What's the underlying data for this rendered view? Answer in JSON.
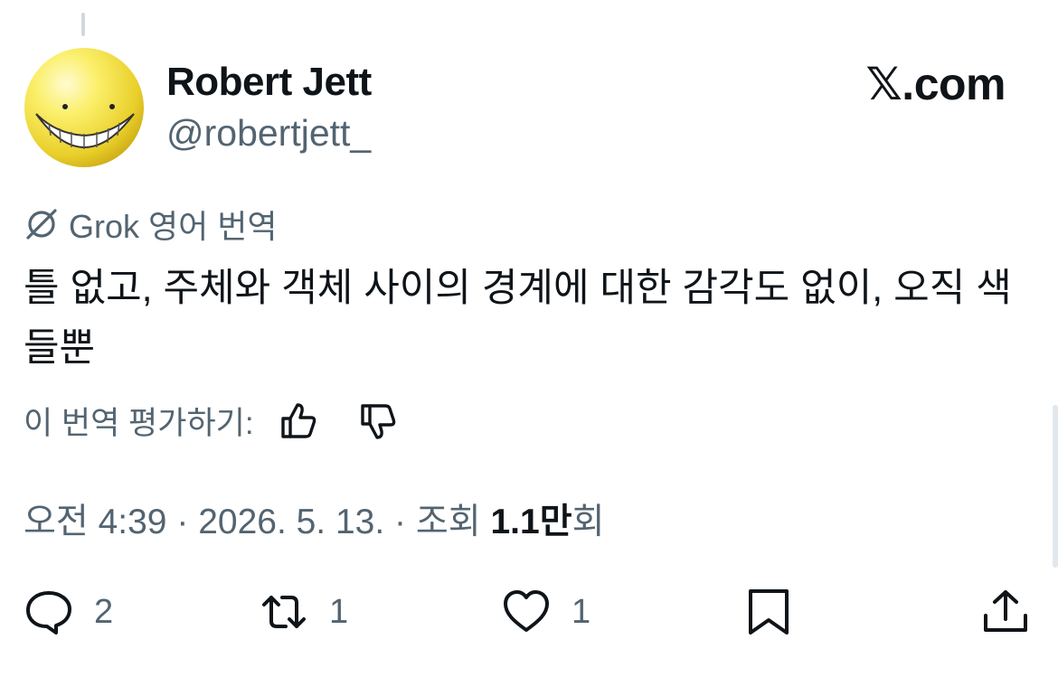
{
  "author": {
    "display_name": "Robert Jett",
    "handle": "@robertjett_",
    "avatar_icon": "yellow-smiley-face-icon"
  },
  "brand": {
    "label": "𝕏.com"
  },
  "translation": {
    "label": "Grok 영어 번역",
    "icon": "grok-icon",
    "rate_prompt": "이 번역 평가하기:",
    "thumbs_up_icon": "thumbs-up-icon",
    "thumbs_down_icon": "thumbs-down-icon"
  },
  "tweet": {
    "text": "틀 없고, 주체와 객체 사이의 경계에 대한 감각도 없이, 오직 색들뿐"
  },
  "meta": {
    "time": "오전 4:39",
    "separator": " · ",
    "date": "2026. 5. 13.",
    "views_label": "조회",
    "views_number": "1.1만",
    "views_suffix": "회"
  },
  "actions": {
    "reply": {
      "icon": "reply-icon",
      "count": "2"
    },
    "repost": {
      "icon": "repost-icon",
      "count": "1"
    },
    "like": {
      "icon": "heart-icon",
      "count": "1"
    },
    "bookmark": {
      "icon": "bookmark-icon"
    },
    "share": {
      "icon": "share-icon"
    }
  },
  "colors": {
    "text_primary": "#0f1419",
    "text_secondary": "#536471",
    "avatar_yellow": "#f5e24a"
  }
}
